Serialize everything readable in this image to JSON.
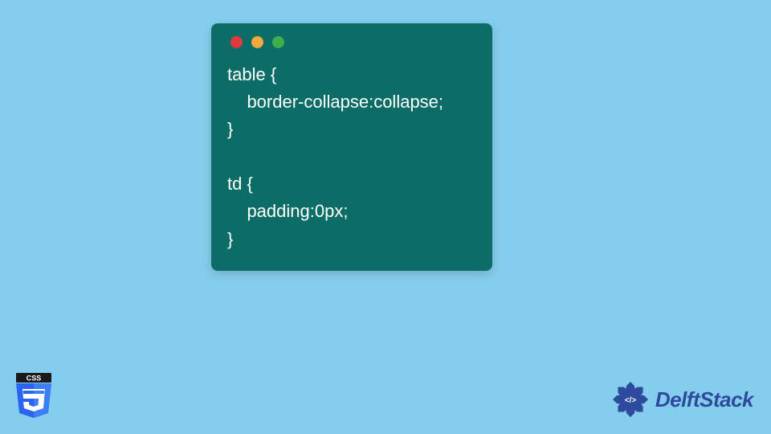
{
  "code_window": {
    "lines": [
      "table {",
      "    border-collapse:collapse;",
      "}",
      "",
      "td {",
      "    padding:0px;",
      "}"
    ]
  },
  "badges": {
    "css_label": "CSS",
    "brand_name": "DelftStack"
  },
  "colors": {
    "background": "#85cdec",
    "window_bg": "#0b6d66",
    "dot_red": "#e0393e",
    "dot_yellow": "#f0a93a",
    "dot_green": "#3fae4c",
    "css_shield_top": "#1a1a1a",
    "css_shield_main": "#2965f1",
    "css_shield_light": "#5a9bf8",
    "brand_blue": "#2d4a9e"
  }
}
